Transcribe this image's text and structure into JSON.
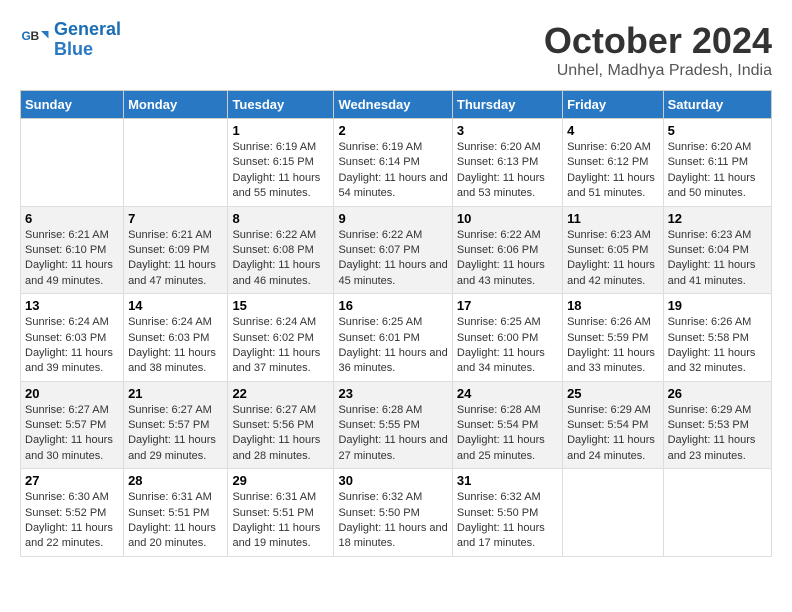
{
  "header": {
    "logo_line1": "General",
    "logo_line2": "Blue",
    "month": "October 2024",
    "location": "Unhel, Madhya Pradesh, India"
  },
  "weekdays": [
    "Sunday",
    "Monday",
    "Tuesday",
    "Wednesday",
    "Thursday",
    "Friday",
    "Saturday"
  ],
  "weeks": [
    [
      {
        "day": "",
        "info": ""
      },
      {
        "day": "",
        "info": ""
      },
      {
        "day": "1",
        "info": "Sunrise: 6:19 AM\nSunset: 6:15 PM\nDaylight: 11 hours and 55 minutes."
      },
      {
        "day": "2",
        "info": "Sunrise: 6:19 AM\nSunset: 6:14 PM\nDaylight: 11 hours and 54 minutes."
      },
      {
        "day": "3",
        "info": "Sunrise: 6:20 AM\nSunset: 6:13 PM\nDaylight: 11 hours and 53 minutes."
      },
      {
        "day": "4",
        "info": "Sunrise: 6:20 AM\nSunset: 6:12 PM\nDaylight: 11 hours and 51 minutes."
      },
      {
        "day": "5",
        "info": "Sunrise: 6:20 AM\nSunset: 6:11 PM\nDaylight: 11 hours and 50 minutes."
      }
    ],
    [
      {
        "day": "6",
        "info": "Sunrise: 6:21 AM\nSunset: 6:10 PM\nDaylight: 11 hours and 49 minutes."
      },
      {
        "day": "7",
        "info": "Sunrise: 6:21 AM\nSunset: 6:09 PM\nDaylight: 11 hours and 47 minutes."
      },
      {
        "day": "8",
        "info": "Sunrise: 6:22 AM\nSunset: 6:08 PM\nDaylight: 11 hours and 46 minutes."
      },
      {
        "day": "9",
        "info": "Sunrise: 6:22 AM\nSunset: 6:07 PM\nDaylight: 11 hours and 45 minutes."
      },
      {
        "day": "10",
        "info": "Sunrise: 6:22 AM\nSunset: 6:06 PM\nDaylight: 11 hours and 43 minutes."
      },
      {
        "day": "11",
        "info": "Sunrise: 6:23 AM\nSunset: 6:05 PM\nDaylight: 11 hours and 42 minutes."
      },
      {
        "day": "12",
        "info": "Sunrise: 6:23 AM\nSunset: 6:04 PM\nDaylight: 11 hours and 41 minutes."
      }
    ],
    [
      {
        "day": "13",
        "info": "Sunrise: 6:24 AM\nSunset: 6:03 PM\nDaylight: 11 hours and 39 minutes."
      },
      {
        "day": "14",
        "info": "Sunrise: 6:24 AM\nSunset: 6:03 PM\nDaylight: 11 hours and 38 minutes."
      },
      {
        "day": "15",
        "info": "Sunrise: 6:24 AM\nSunset: 6:02 PM\nDaylight: 11 hours and 37 minutes."
      },
      {
        "day": "16",
        "info": "Sunrise: 6:25 AM\nSunset: 6:01 PM\nDaylight: 11 hours and 36 minutes."
      },
      {
        "day": "17",
        "info": "Sunrise: 6:25 AM\nSunset: 6:00 PM\nDaylight: 11 hours and 34 minutes."
      },
      {
        "day": "18",
        "info": "Sunrise: 6:26 AM\nSunset: 5:59 PM\nDaylight: 11 hours and 33 minutes."
      },
      {
        "day": "19",
        "info": "Sunrise: 6:26 AM\nSunset: 5:58 PM\nDaylight: 11 hours and 32 minutes."
      }
    ],
    [
      {
        "day": "20",
        "info": "Sunrise: 6:27 AM\nSunset: 5:57 PM\nDaylight: 11 hours and 30 minutes."
      },
      {
        "day": "21",
        "info": "Sunrise: 6:27 AM\nSunset: 5:57 PM\nDaylight: 11 hours and 29 minutes."
      },
      {
        "day": "22",
        "info": "Sunrise: 6:27 AM\nSunset: 5:56 PM\nDaylight: 11 hours and 28 minutes."
      },
      {
        "day": "23",
        "info": "Sunrise: 6:28 AM\nSunset: 5:55 PM\nDaylight: 11 hours and 27 minutes."
      },
      {
        "day": "24",
        "info": "Sunrise: 6:28 AM\nSunset: 5:54 PM\nDaylight: 11 hours and 25 minutes."
      },
      {
        "day": "25",
        "info": "Sunrise: 6:29 AM\nSunset: 5:54 PM\nDaylight: 11 hours and 24 minutes."
      },
      {
        "day": "26",
        "info": "Sunrise: 6:29 AM\nSunset: 5:53 PM\nDaylight: 11 hours and 23 minutes."
      }
    ],
    [
      {
        "day": "27",
        "info": "Sunrise: 6:30 AM\nSunset: 5:52 PM\nDaylight: 11 hours and 22 minutes."
      },
      {
        "day": "28",
        "info": "Sunrise: 6:31 AM\nSunset: 5:51 PM\nDaylight: 11 hours and 20 minutes."
      },
      {
        "day": "29",
        "info": "Sunrise: 6:31 AM\nSunset: 5:51 PM\nDaylight: 11 hours and 19 minutes."
      },
      {
        "day": "30",
        "info": "Sunrise: 6:32 AM\nSunset: 5:50 PM\nDaylight: 11 hours and 18 minutes."
      },
      {
        "day": "31",
        "info": "Sunrise: 6:32 AM\nSunset: 5:50 PM\nDaylight: 11 hours and 17 minutes."
      },
      {
        "day": "",
        "info": ""
      },
      {
        "day": "",
        "info": ""
      }
    ]
  ]
}
